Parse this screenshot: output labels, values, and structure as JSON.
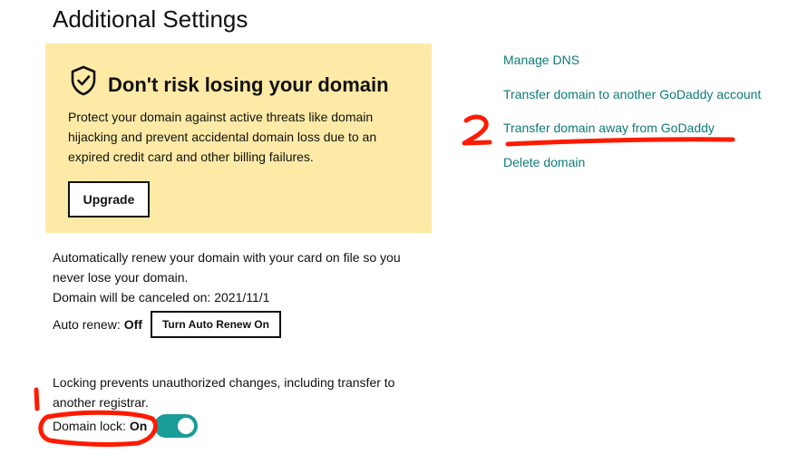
{
  "page": {
    "title": "Additional Settings"
  },
  "promo": {
    "title": "Don't risk losing your domain",
    "body": "Protect your domain against active threats like domain hijacking and prevent accidental domain loss due to an expired credit card and other billing failures.",
    "upgrade_label": "Upgrade",
    "icon": "shield-check-icon"
  },
  "renewal": {
    "description": "Automatically renew your domain with your card on file so you never lose your domain.",
    "cancel_label": "Domain will be canceled on:",
    "cancel_date": "2021/11/1",
    "auto_renew_label": "Auto renew:",
    "auto_renew_value": "Off",
    "turn_on_label": "Turn Auto Renew On"
  },
  "lock": {
    "description": "Locking prevents unauthorized changes, including transfer to another registrar.",
    "label": "Domain lock:",
    "value": "On",
    "enabled": true
  },
  "links": [
    {
      "label": "Manage DNS"
    },
    {
      "label": "Transfer domain to another GoDaddy account"
    },
    {
      "label": "Transfer domain away from GoDaddy"
    },
    {
      "label": "Delete domain"
    }
  ],
  "annotations": {
    "color": "#ff1a00",
    "step_one_label": "1",
    "step_two_label": "2"
  },
  "colors": {
    "promo_background": "#fdeaa6",
    "link": "#0d7b78",
    "toggle_on": "#1a9c99"
  }
}
